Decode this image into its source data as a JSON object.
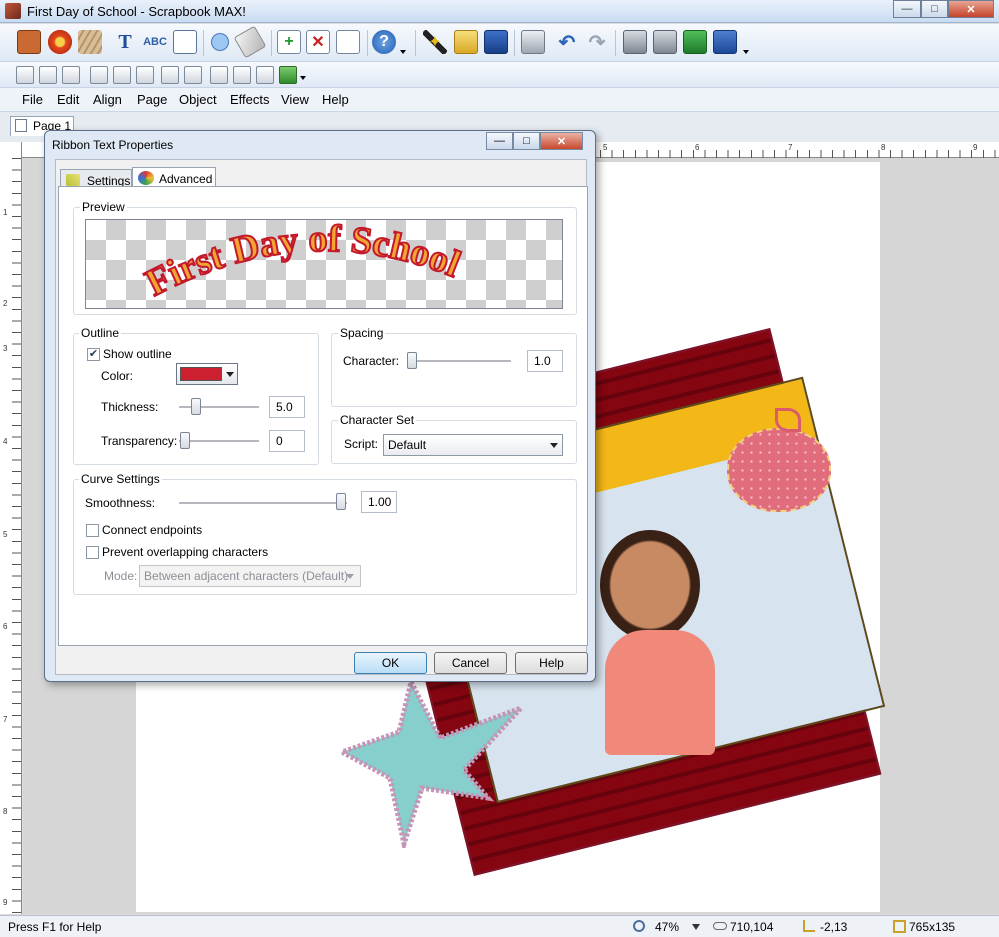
{
  "app": {
    "title": "First Day of School - Scrapbook MAX!"
  },
  "window_controls": {
    "minimize": "—",
    "maximize": "□",
    "close": "✕"
  },
  "toolbar1": {
    "icons": [
      "photo-icon",
      "flower-icon",
      "paper-icon",
      "text-icon",
      "spellcheck-icon",
      "notes-icon",
      "zoom-icon",
      "eraser-icon",
      "new-page-icon",
      "delete-page-icon",
      "page-icon",
      "help-icon",
      "magic-wand-icon",
      "open-folder-icon",
      "save-icon",
      "print-icon",
      "undo-icon",
      "redo-icon",
      "bring-front-icon",
      "send-back-icon",
      "layer-up-icon",
      "layer-down-icon"
    ]
  },
  "menu": {
    "items": [
      "File",
      "Edit",
      "Align",
      "Page",
      "Object",
      "Effects",
      "View",
      "Help"
    ]
  },
  "tabs": {
    "page": "Page 1"
  },
  "ruler": {
    "h_numbers": [
      "5",
      "6",
      "7",
      "8",
      "9"
    ],
    "v_numbers": [
      "1",
      "2",
      "3",
      "4",
      "5",
      "6",
      "7",
      "8",
      "9"
    ]
  },
  "status": {
    "help": "Press F1 for Help",
    "zoom": "47%",
    "cursor": "710,104",
    "position": "-2,13",
    "size": "765x135"
  },
  "dialog": {
    "title": "Ribbon Text Properties",
    "tabs": {
      "settings": "Settings",
      "advanced": "Advanced"
    },
    "preview": {
      "label": "Preview",
      "text": "First Day of School",
      "fill_color": "#f2a531",
      "outline_color": "#c4192d"
    },
    "outline": {
      "label": "Outline",
      "show_label": "Show outline",
      "show_checked": true,
      "color_label": "Color:",
      "color_value": "#cc2030",
      "thickness_label": "Thickness:",
      "thickness_value": "5.0",
      "transparency_label": "Transparency:",
      "transparency_value": "0"
    },
    "spacing": {
      "label": "Spacing",
      "character_label": "Character:",
      "character_value": "1.0"
    },
    "charset": {
      "label": "Character Set",
      "script_label": "Script:",
      "script_value": "Default"
    },
    "curve": {
      "label": "Curve Settings",
      "smoothness_label": "Smoothness:",
      "smoothness_value": "1.00",
      "connect_label": "Connect endpoints",
      "prevent_label": "Prevent overlapping characters",
      "mode_label": "Mode:",
      "mode_value": "Between adjacent characters (Default)"
    },
    "buttons": {
      "ok": "OK",
      "cancel": "Cancel",
      "help": "Help"
    }
  }
}
